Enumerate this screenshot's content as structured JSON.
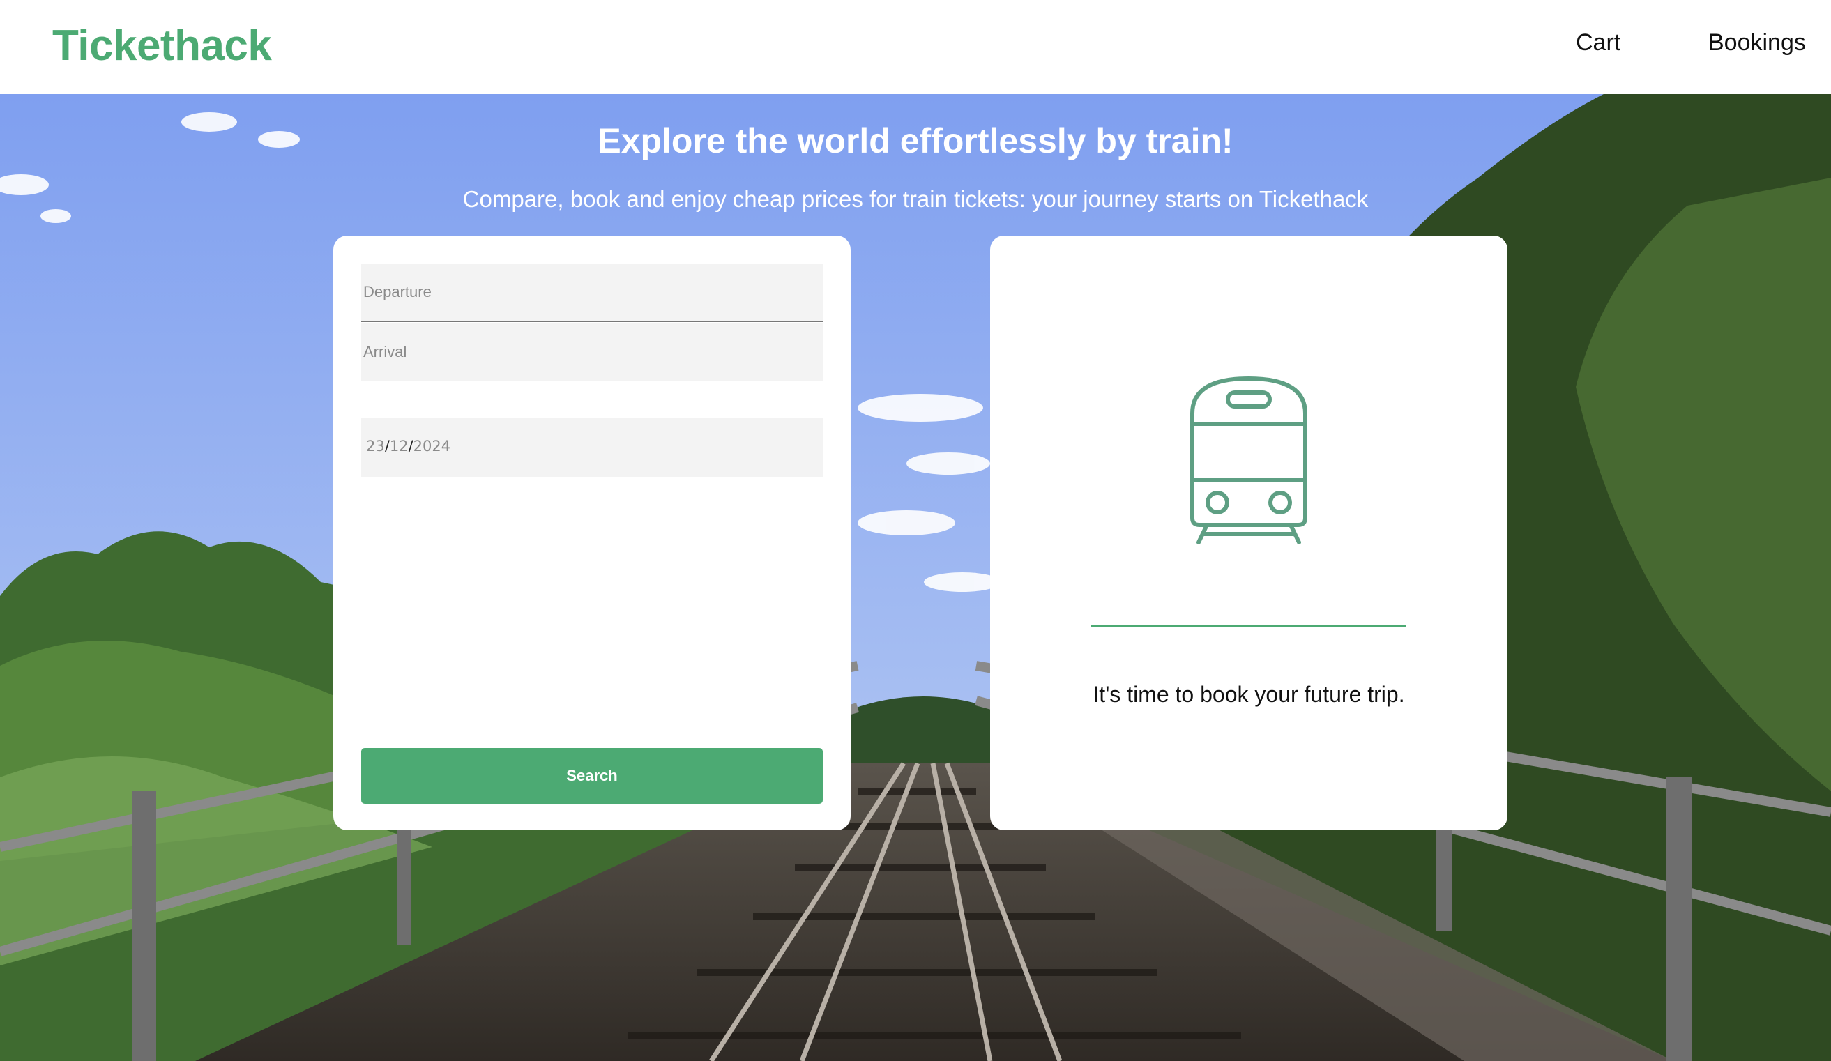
{
  "header": {
    "logo": "Tickethack",
    "nav": {
      "cart": "Cart",
      "bookings": "Bookings"
    }
  },
  "hero": {
    "title": "Explore the world effortlessly by train!",
    "subtitle": "Compare, book and enjoy cheap prices for train tickets: your journey starts on Tickethack"
  },
  "search_form": {
    "departure_placeholder": "Departure",
    "arrival_placeholder": "Arrival",
    "date": {
      "day": "23",
      "month": "12",
      "year": "2024",
      "separator": "/"
    },
    "search_label": "Search"
  },
  "result_panel": {
    "message": "It's time to book your future trip.",
    "icon": "train-icon"
  },
  "colors": {
    "brand_green": "#4caa73",
    "train_icon_stroke": "#5e9f83",
    "sky": "#8cabf0"
  }
}
